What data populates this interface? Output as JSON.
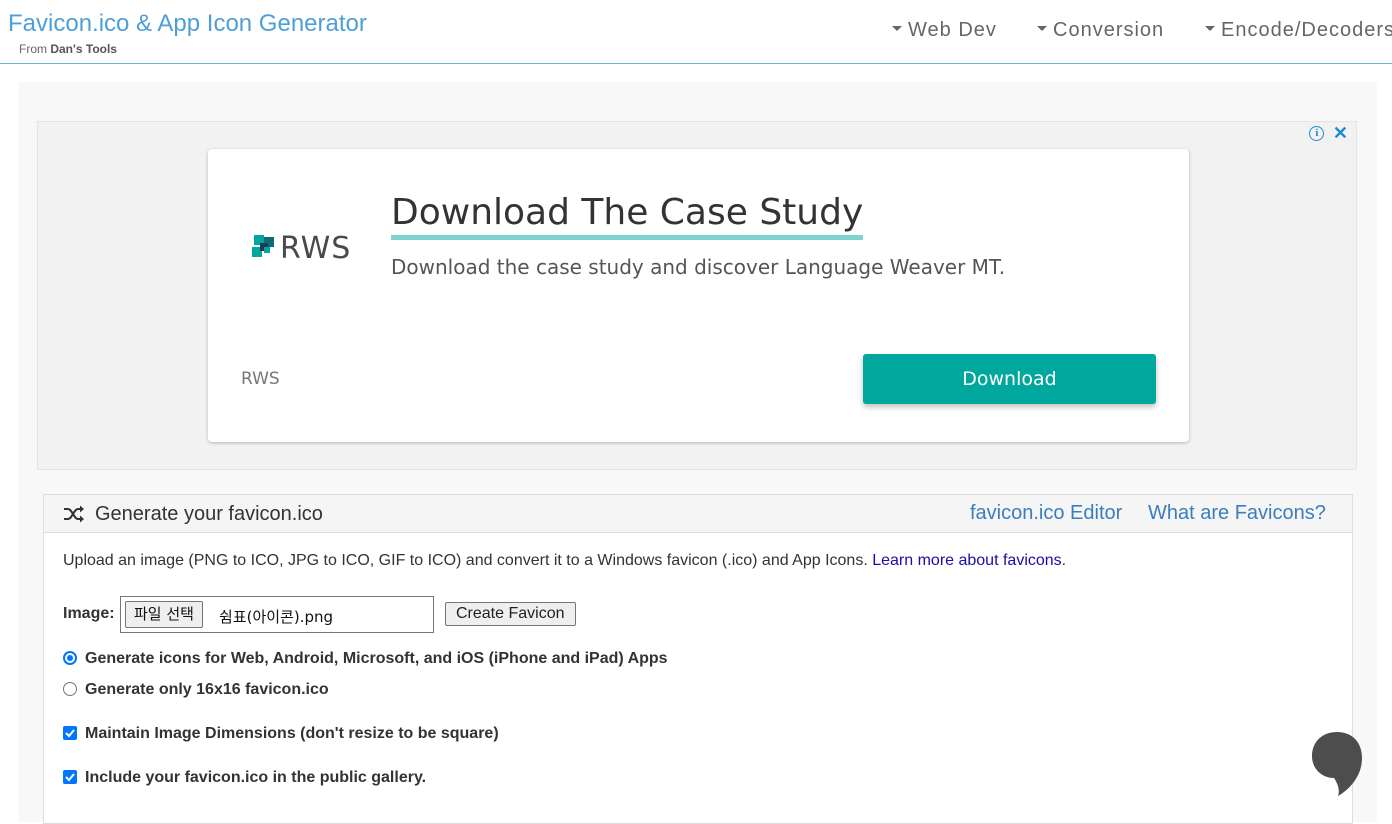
{
  "header": {
    "title": "Favicon.ico & App Icon Generator",
    "subtitle_prefix": "From ",
    "subtitle_brand": "Dan's Tools",
    "nav": [
      {
        "label": "Web Dev"
      },
      {
        "label": "Conversion"
      },
      {
        "label": "Encode/Decoders"
      }
    ]
  },
  "ad": {
    "info_icon": "info-icon",
    "close_icon": "close-icon",
    "logo_text": "RWS",
    "headline": "Download The Case Study",
    "description": "Download the case study and discover Language Weaver MT.",
    "advertiser": "RWS",
    "cta_label": "Download",
    "cta_color": "#00a79d",
    "headline_underline_color": "#7dd3cf"
  },
  "generator": {
    "icon": "shuffle-icon",
    "title": "Generate your favicon.ico",
    "links": [
      {
        "label": "favicon.ico Editor"
      },
      {
        "label": "What are Favicons?"
      }
    ],
    "intro": "Upload an image (PNG to ICO, JPG to ICO, GIF to ICO) and convert it to a Windows favicon (.ico) and App Icons. ",
    "intro_link": "Learn more about favicons",
    "intro_end": ".",
    "image_label": "Image:",
    "file_button_label": "파일 선택",
    "file_name": "쉼표(아이콘).png",
    "create_button_label": "Create Favicon",
    "options": [
      {
        "type": "radio",
        "checked": true,
        "label": "Generate icons for Web, Android, Microsoft, and iOS (iPhone and iPad) Apps"
      },
      {
        "type": "radio",
        "checked": false,
        "label": "Generate only 16x16 favicon.ico"
      },
      {
        "type": "checkbox",
        "checked": true,
        "label": "Maintain Image Dimensions (don't resize to be square)"
      },
      {
        "type": "checkbox",
        "checked": true,
        "label": "Include your favicon.ico in the public gallery."
      }
    ]
  },
  "colors": {
    "brand": "#4e9fd8",
    "link": "#3a7ebf",
    "accent": "#0075ff"
  }
}
